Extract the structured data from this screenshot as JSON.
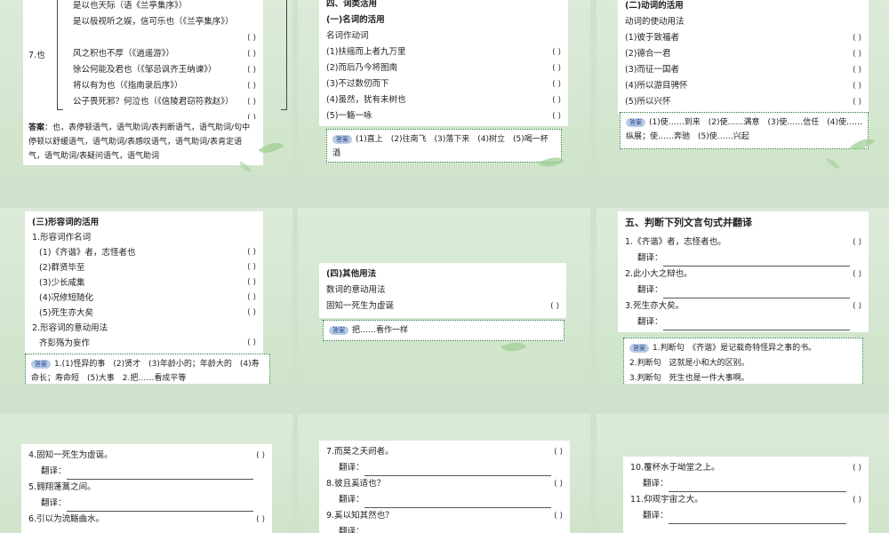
{
  "t1": {
    "lines": [
      "是以也天际（语《兰亭集序》）",
      "是以极视听之娱，信可乐也（《兰亭集序》）",
      "",
      "风之积也不厚（《逍遥游》）",
      "徐公何能及君也（《邹忌讽齐王纳谏》）",
      "将以有为也（《指南录后序》）",
      "公子畏死邪？何泣也（《信陵君窃符救赵》）",
      ""
    ],
    "group": "7.也",
    "paren": "(        )",
    "answer_label": "答案",
    "answer": "：也，表停顿语气，语气助词/表判断语气，语气助词/句中停顿以舒缓语气，语气助词/表感叹语气，语气助词/表肯定语气，语气助词/表疑问语气，语气助词"
  },
  "t2": {
    "header": "四、词类活用",
    "sub": "(一)名词的活用",
    "sub2": "名词作动词",
    "items": [
      "(1)扶摇而上者九万里",
      "(2)而后乃今将图南",
      "(3)不过数仞而下",
      "(4)虽然，犹有未树也",
      "(5)一觞一咏"
    ],
    "paren": "(        )",
    "badge": "答案",
    "answer": "(1)直上　(2)往南飞　(3)落下来　(4)树立　(5)喝一杯酒"
  },
  "t3": {
    "sub": "(二)动词的活用",
    "sub2": "动词的使动用法",
    "items": [
      "(1)彼于致福者",
      "(2)德合一君",
      "(3)而征一国者",
      "(4)所以游目骋怀",
      "(5)所以兴怀"
    ],
    "paren": "(        )",
    "badge": "答案",
    "answer": "(1)使……到来　(2)使……满意　(3)使……信任　(4)使……纵展；使……奔驰　(5)使……兴起"
  },
  "t4": {
    "sub": "(三)形容词的活用",
    "sub2": "1.形容词作名词",
    "items": [
      "(1)《齐谐》者，志怪者也",
      "(2)群贤毕至",
      "(3)少长咸集",
      "(4)况修短随化",
      "(5)死生亦大矣"
    ],
    "sub3": "2.形容词的意动用法",
    "item6": "齐彭殇为妄作",
    "paren": "(        )",
    "badge": "答案",
    "answer": "1.(1)怪异的事　(2)贤才　(3)年龄小的；年龄大的　(4)寿命长；寿命短　(5)大事　2.把……看成平等"
  },
  "t5": {
    "sub": "(四)其他用法",
    "sub2": "数词的意动用法",
    "item": "固知一死生为虚诞",
    "paren": "(        )",
    "badge": "答案",
    "answer": "把……看作一样"
  },
  "t6": {
    "header": "五、判断下列文言句式并翻译",
    "items": [
      "1.《齐谐》者，志怪者也。",
      "2.此小大之辩也。",
      "3.死生亦大矣。"
    ],
    "trans": "翻译：",
    "paren": "(        )",
    "badge": "答案",
    "answer": [
      "1.判断句　《齐谐》是记载奇特怪异之事的书。",
      "2.判断句　这就是小和大的区别。",
      "3.判断句　死生也是一件大事啊。"
    ]
  },
  "t7": {
    "items": [
      "4.固知一死生为虚诞。",
      "5.翱翔蓬蒿之间。",
      "6.引以为流觞曲水。"
    ],
    "trans": "翻译：",
    "paren": "(        )"
  },
  "t8": {
    "items": [
      "7.而莫之夭阏者。",
      "8.彼且奚适也？",
      "9.奚以知其然也？"
    ],
    "trans": "翻译：",
    "paren": "(        )"
  },
  "t9": {
    "items": [
      "10.覆杯水于坳堂之上。",
      "11.仰观宇宙之大。"
    ],
    "trans": "翻译：",
    "paren": "(        )"
  }
}
